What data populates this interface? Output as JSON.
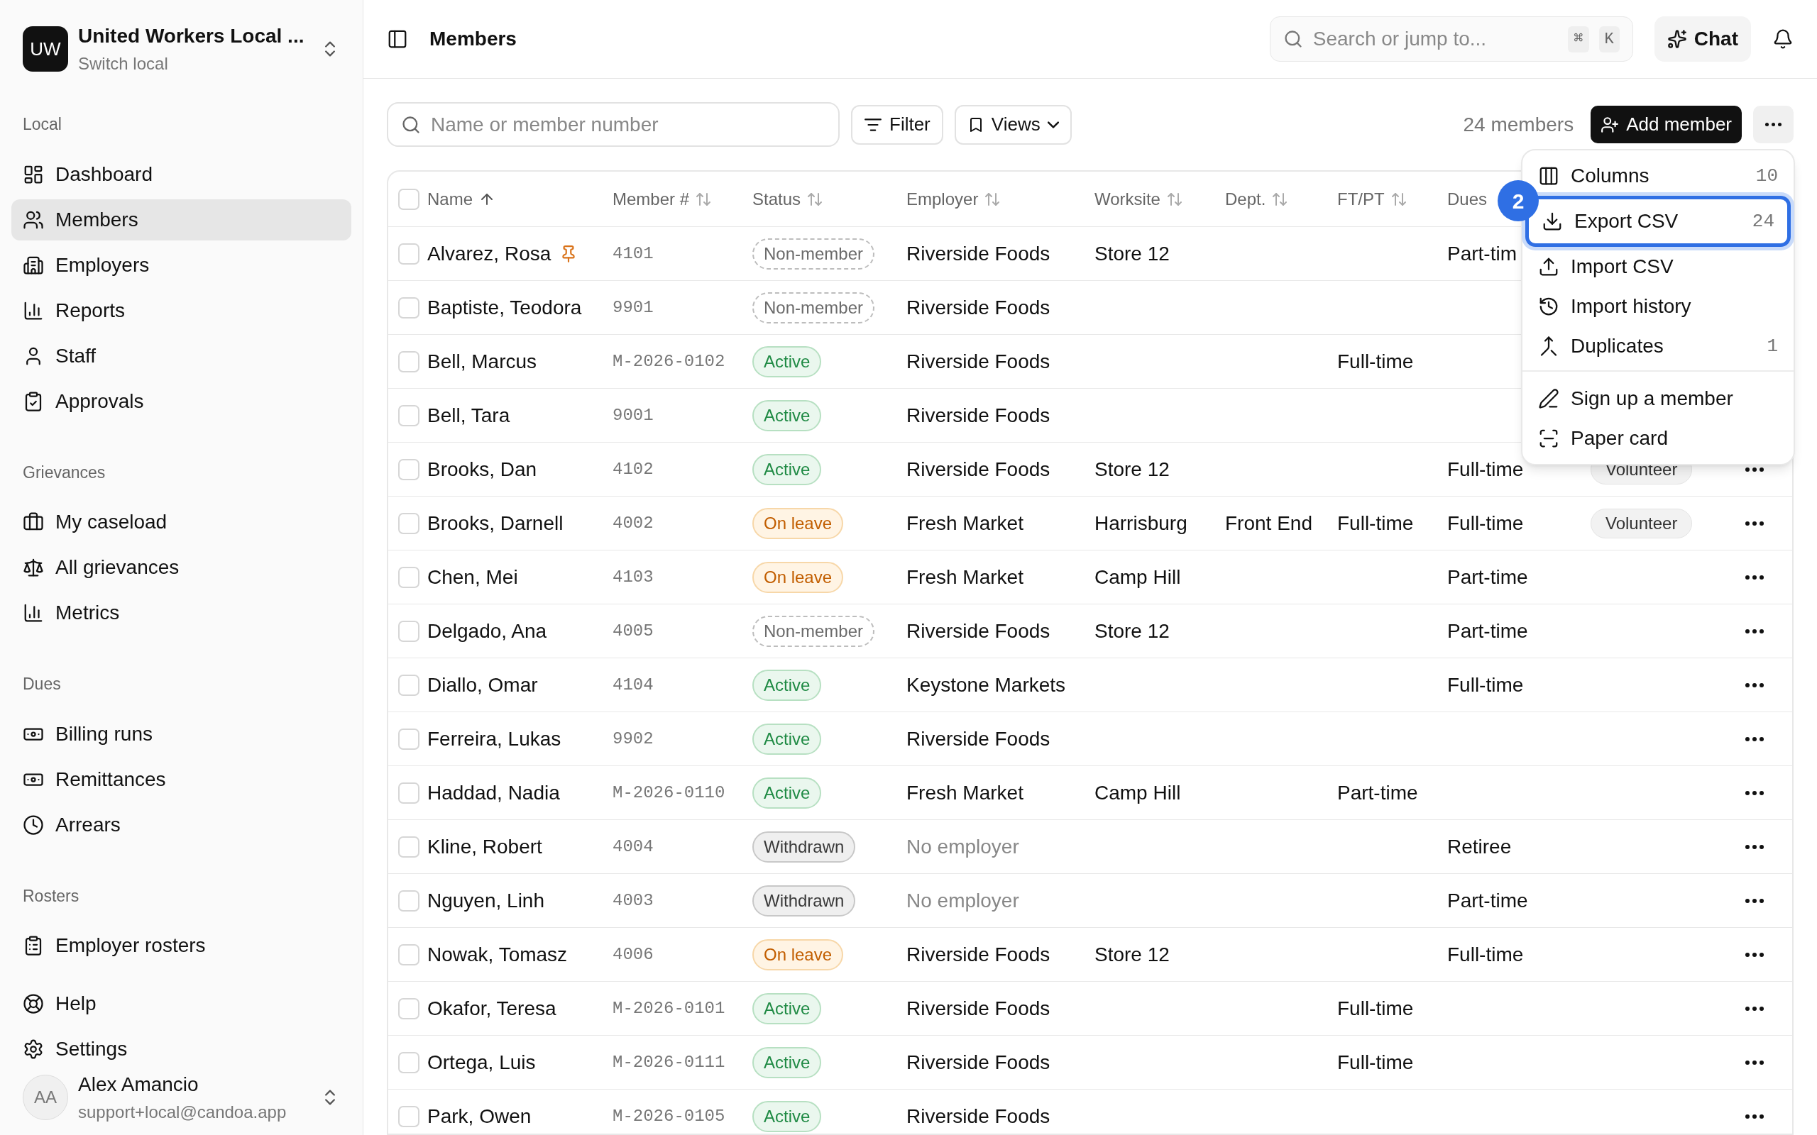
{
  "sidebar": {
    "org": {
      "initials": "UW",
      "name": "United Workers Local ...",
      "subtitle": "Switch local"
    },
    "sections": [
      {
        "title": "Local",
        "items": [
          {
            "label": "Dashboard",
            "selected": false
          },
          {
            "label": "Members",
            "selected": true
          },
          {
            "label": "Employers",
            "selected": false
          },
          {
            "label": "Reports",
            "selected": false
          },
          {
            "label": "Staff",
            "selected": false
          },
          {
            "label": "Approvals",
            "selected": false
          }
        ]
      },
      {
        "title": "Grievances",
        "items": [
          {
            "label": "My caseload",
            "selected": false
          },
          {
            "label": "All grievances",
            "selected": false
          },
          {
            "label": "Metrics",
            "selected": false
          }
        ]
      },
      {
        "title": "Dues",
        "items": [
          {
            "label": "Billing runs",
            "selected": false
          },
          {
            "label": "Remittances",
            "selected": false
          },
          {
            "label": "Arrears",
            "selected": false
          }
        ]
      },
      {
        "title": "Rosters",
        "items": [
          {
            "label": "Employer rosters",
            "selected": false
          }
        ]
      }
    ],
    "footer_items": [
      {
        "label": "Help",
        "selected": false
      },
      {
        "label": "Settings",
        "selected": false
      }
    ],
    "user": {
      "initials": "AA",
      "name": "Alex Amancio",
      "email": "support+local@candoa.app"
    }
  },
  "header": {
    "title": "Members",
    "search": {
      "placeholder": "Search or jump to...",
      "keys": [
        "⌘",
        "K"
      ]
    },
    "chat": "Chat"
  },
  "toolbar": {
    "search": {
      "placeholder": "Name or member number"
    },
    "filter": "Filter",
    "views": "Views",
    "count": "24 members",
    "add": "Add member"
  },
  "table": {
    "all_checked": false,
    "columns": [
      {
        "label": "Name",
        "sorted": true
      },
      {
        "label": "Member #",
        "sorted": false
      },
      {
        "label": "Status",
        "sorted": false
      },
      {
        "label": "Employer",
        "sorted": false
      },
      {
        "label": "Worksite",
        "sorted": false
      },
      {
        "label": "Dept.",
        "sorted": false
      },
      {
        "label": "FT/PT",
        "sorted": false
      },
      {
        "label": "Dues"
      }
    ],
    "rows": [
      {
        "checked": false,
        "name": "Alvarez, Rosa",
        "pinned": true,
        "member_no": "4101",
        "status": {
          "label": "Non-member",
          "kind": "non_member"
        },
        "employer": "Riverside Foods",
        "employer_muted": false,
        "worksite": "Store 12",
        "dept": "",
        "ft_pt": "",
        "dues": "Part-tim",
        "tag": ""
      },
      {
        "checked": false,
        "name": "Baptiste, Teodora",
        "pinned": false,
        "member_no": "9901",
        "status": {
          "label": "Non-member",
          "kind": "non_member"
        },
        "employer": "Riverside Foods",
        "employer_muted": false,
        "worksite": "",
        "dept": "",
        "ft_pt": "",
        "dues": "",
        "tag": ""
      },
      {
        "checked": false,
        "name": "Bell, Marcus",
        "pinned": false,
        "member_no": "M-2026-0102",
        "status": {
          "label": "Active",
          "kind": "active"
        },
        "employer": "Riverside Foods",
        "employer_muted": false,
        "worksite": "",
        "dept": "",
        "ft_pt": "Full-time",
        "dues": "",
        "tag": ""
      },
      {
        "checked": false,
        "name": "Bell, Tara",
        "pinned": false,
        "member_no": "9001",
        "status": {
          "label": "Active",
          "kind": "active"
        },
        "employer": "Riverside Foods",
        "employer_muted": false,
        "worksite": "",
        "dept": "",
        "ft_pt": "",
        "dues": "",
        "tag": ""
      },
      {
        "checked": false,
        "name": "Brooks, Dan",
        "pinned": false,
        "member_no": "4102",
        "status": {
          "label": "Active",
          "kind": "active"
        },
        "employer": "Riverside Foods",
        "employer_muted": false,
        "worksite": "Store 12",
        "dept": "",
        "ft_pt": "",
        "dues": "Full-time",
        "tag": "Volunteer"
      },
      {
        "checked": false,
        "name": "Brooks, Darnell",
        "pinned": false,
        "member_no": "4002",
        "status": {
          "label": "On leave",
          "kind": "on_leave"
        },
        "employer": "Fresh Market",
        "employer_muted": false,
        "worksite": "Harrisburg",
        "dept": "Front End",
        "ft_pt": "Full-time",
        "dues": "Full-time",
        "tag": "Volunteer"
      },
      {
        "checked": false,
        "name": "Chen, Mei",
        "pinned": false,
        "member_no": "4103",
        "status": {
          "label": "On leave",
          "kind": "on_leave"
        },
        "employer": "Fresh Market",
        "employer_muted": false,
        "worksite": "Camp Hill",
        "dept": "",
        "ft_pt": "",
        "dues": "Part-time",
        "tag": ""
      },
      {
        "checked": false,
        "name": "Delgado, Ana",
        "pinned": false,
        "member_no": "4005",
        "status": {
          "label": "Non-member",
          "kind": "non_member"
        },
        "employer": "Riverside Foods",
        "employer_muted": false,
        "worksite": "Store 12",
        "dept": "",
        "ft_pt": "",
        "dues": "Part-time",
        "tag": ""
      },
      {
        "checked": false,
        "name": "Diallo, Omar",
        "pinned": false,
        "member_no": "4104",
        "status": {
          "label": "Active",
          "kind": "active"
        },
        "employer": "Keystone Markets",
        "employer_muted": false,
        "worksite": "",
        "dept": "",
        "ft_pt": "",
        "dues": "Full-time",
        "tag": ""
      },
      {
        "checked": false,
        "name": "Ferreira, Lukas",
        "pinned": false,
        "member_no": "9902",
        "status": {
          "label": "Active",
          "kind": "active"
        },
        "employer": "Riverside Foods",
        "employer_muted": false,
        "worksite": "",
        "dept": "",
        "ft_pt": "",
        "dues": "",
        "tag": ""
      },
      {
        "checked": false,
        "name": "Haddad, Nadia",
        "pinned": false,
        "member_no": "M-2026-0110",
        "status": {
          "label": "Active",
          "kind": "active"
        },
        "employer": "Fresh Market",
        "employer_muted": false,
        "worksite": "Camp Hill",
        "dept": "",
        "ft_pt": "Part-time",
        "dues": "",
        "tag": ""
      },
      {
        "checked": false,
        "name": "Kline, Robert",
        "pinned": false,
        "member_no": "4004",
        "status": {
          "label": "Withdrawn",
          "kind": "withdrawn"
        },
        "employer": "No employer",
        "employer_muted": true,
        "worksite": "",
        "dept": "",
        "ft_pt": "",
        "dues": "Retiree",
        "tag": ""
      },
      {
        "checked": false,
        "name": "Nguyen, Linh",
        "pinned": false,
        "member_no": "4003",
        "status": {
          "label": "Withdrawn",
          "kind": "withdrawn"
        },
        "employer": "No employer",
        "employer_muted": true,
        "worksite": "",
        "dept": "",
        "ft_pt": "",
        "dues": "Part-time",
        "tag": ""
      },
      {
        "checked": false,
        "name": "Nowak, Tomasz",
        "pinned": false,
        "member_no": "4006",
        "status": {
          "label": "On leave",
          "kind": "on_leave"
        },
        "employer": "Riverside Foods",
        "employer_muted": false,
        "worksite": "Store 12",
        "dept": "",
        "ft_pt": "",
        "dues": "Full-time",
        "tag": ""
      },
      {
        "checked": false,
        "name": "Okafor, Teresa",
        "pinned": false,
        "member_no": "M-2026-0101",
        "status": {
          "label": "Active",
          "kind": "active"
        },
        "employer": "Riverside Foods",
        "employer_muted": false,
        "worksite": "",
        "dept": "",
        "ft_pt": "Full-time",
        "dues": "",
        "tag": ""
      },
      {
        "checked": false,
        "name": "Ortega, Luis",
        "pinned": false,
        "member_no": "M-2026-0111",
        "status": {
          "label": "Active",
          "kind": "active"
        },
        "employer": "Riverside Foods",
        "employer_muted": false,
        "worksite": "",
        "dept": "",
        "ft_pt": "Full-time",
        "dues": "",
        "tag": ""
      },
      {
        "checked": false,
        "name": "Park, Owen",
        "pinned": false,
        "member_no": "M-2026-0105",
        "status": {
          "label": "Active",
          "kind": "active"
        },
        "employer": "Riverside Foods",
        "employer_muted": false,
        "worksite": "",
        "dept": "",
        "ft_pt": "",
        "dues": "",
        "tag": ""
      }
    ]
  },
  "menu": {
    "step_badge": "2",
    "groups": [
      [
        {
          "label": "Columns",
          "count": "10",
          "selected": false
        },
        {
          "label": "Export CSV",
          "count": "24",
          "selected": true
        },
        {
          "label": "Import CSV",
          "selected": false
        },
        {
          "label": "Import history",
          "selected": false
        },
        {
          "label": "Duplicates",
          "count": "1",
          "selected": false
        }
      ],
      [
        {
          "label": "Sign up a member",
          "selected": false
        },
        {
          "label": "Paper card",
          "selected": false
        }
      ]
    ]
  }
}
